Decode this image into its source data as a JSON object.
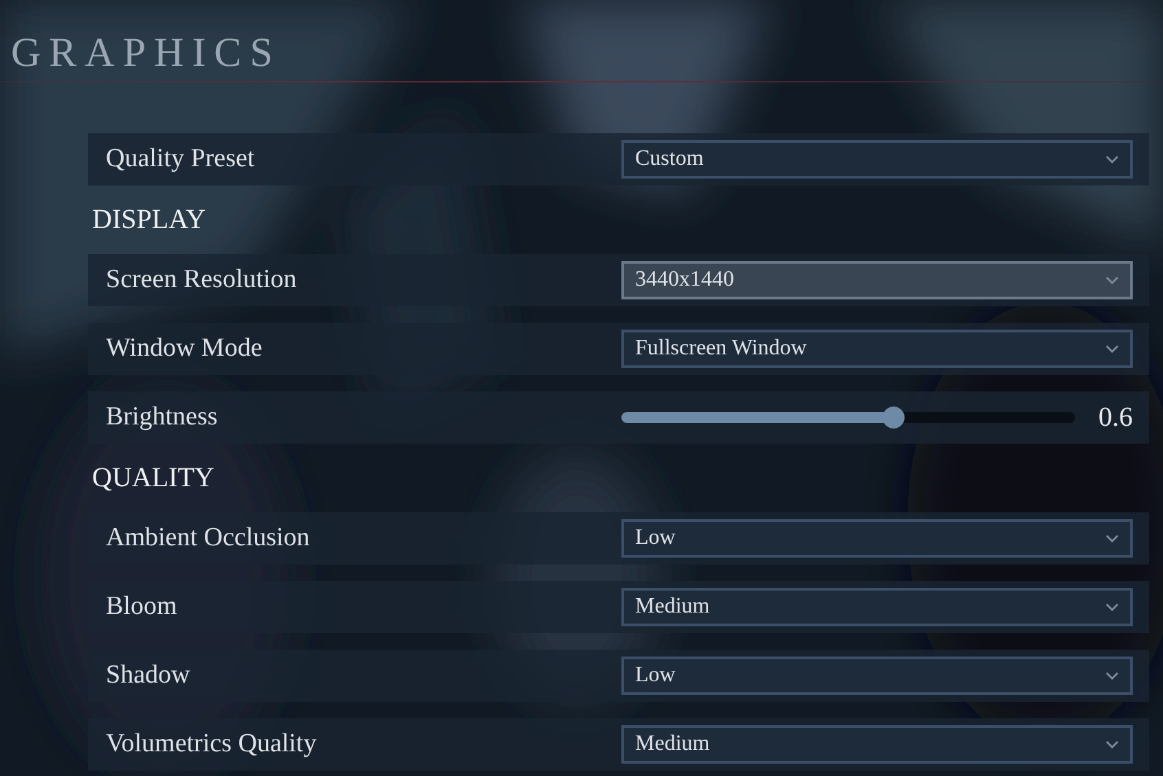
{
  "title": "GRAPHICS",
  "rows": [
    {
      "kind": "dropdown",
      "label": "Quality Preset",
      "value": "Custom",
      "highlighted": false
    },
    {
      "kind": "heading",
      "label": "DISPLAY"
    },
    {
      "kind": "dropdown",
      "label": "Screen Resolution",
      "value": "3440x1440",
      "highlighted": true
    },
    {
      "kind": "dropdown",
      "label": "Window Mode",
      "value": "Fullscreen Window",
      "highlighted": false
    },
    {
      "kind": "slider",
      "label": "Brightness",
      "level": 0.6,
      "reading": "0.6"
    },
    {
      "kind": "heading",
      "label": "QUALITY"
    },
    {
      "kind": "dropdown",
      "label": "Ambient Occlusion",
      "value": "Low",
      "highlighted": false
    },
    {
      "kind": "dropdown",
      "label": "Bloom",
      "value": "Medium",
      "highlighted": false
    },
    {
      "kind": "dropdown",
      "label": "Shadow",
      "value": "Low",
      "highlighted": false
    },
    {
      "kind": "dropdown",
      "label": "Volumetrics Quality",
      "value": "Medium",
      "highlighted": false
    }
  ]
}
